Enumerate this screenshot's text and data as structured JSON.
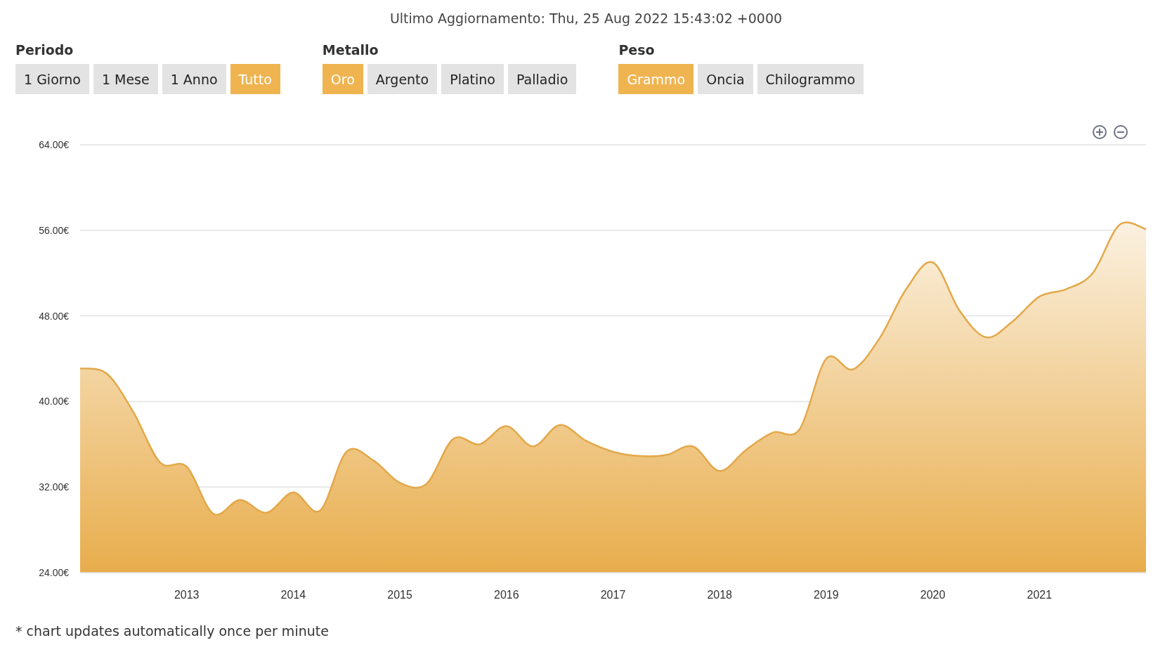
{
  "last_update": "Ultimo Aggiornamento: Thu, 25 Aug 2022 15:43:02 +0000",
  "filter_groups": [
    {
      "label": "Periodo",
      "options": [
        {
          "label": "1 Giorno",
          "selected": false
        },
        {
          "label": "1 Mese",
          "selected": false
        },
        {
          "label": "1 Anno",
          "selected": false
        },
        {
          "label": "Tutto",
          "selected": true
        }
      ]
    },
    {
      "label": "Metallo",
      "options": [
        {
          "label": "Oro",
          "selected": true
        },
        {
          "label": "Argento",
          "selected": false
        },
        {
          "label": "Platino",
          "selected": false
        },
        {
          "label": "Palladio",
          "selected": false
        }
      ]
    },
    {
      "label": "Peso",
      "options": [
        {
          "label": "Grammo",
          "selected": true
        },
        {
          "label": "Oncia",
          "selected": false
        },
        {
          "label": "Chilogrammo",
          "selected": false
        }
      ]
    }
  ],
  "chart": {
    "chart_data": {
      "type": "area",
      "x": [
        2012,
        2012.25,
        2012.5,
        2012.75,
        2013,
        2013.25,
        2013.5,
        2013.75,
        2014,
        2014.25,
        2014.5,
        2014.75,
        2015,
        2015.25,
        2015.5,
        2015.75,
        2016,
        2016.25,
        2016.5,
        2016.75,
        2017,
        2017.25,
        2017.5,
        2017.75,
        2018,
        2018.25,
        2018.5,
        2018.75,
        2019,
        2019.25,
        2019.5,
        2019.75,
        2020,
        2020.25,
        2020.5,
        2020.75,
        2021,
        2021.25,
        2021.5,
        2021.75,
        2022
      ],
      "values": [
        43.1,
        42.6,
        39.0,
        34.3,
        33.9,
        29.5,
        30.8,
        29.6,
        31.5,
        29.8,
        35.3,
        34.5,
        32.4,
        32.3,
        36.5,
        36.0,
        37.7,
        35.8,
        37.8,
        36.3,
        35.3,
        34.9,
        35.0,
        35.8,
        33.5,
        35.5,
        37.1,
        37.4,
        44.0,
        43.0,
        45.9,
        50.5,
        53.0,
        48.5,
        46.0,
        47.5,
        49.8,
        50.5,
        52.0,
        56.5,
        56.1
      ],
      "grid": true,
      "xlim": [
        2012,
        2022
      ],
      "ylim": [
        24,
        64
      ],
      "xticks": [
        2013,
        2014,
        2015,
        2016,
        2017,
        2018,
        2019,
        2020,
        2021
      ],
      "yticks": [
        {
          "value": 24,
          "label": "24.00€"
        },
        {
          "value": 32,
          "label": "32.00€"
        },
        {
          "value": 40,
          "label": "40.00€"
        },
        {
          "value": 48,
          "label": "48.00€"
        },
        {
          "value": 56,
          "label": "56.00€"
        },
        {
          "value": 64,
          "label": "64.00€"
        }
      ]
    }
  },
  "footnote": "* chart updates automatically once per minute"
}
